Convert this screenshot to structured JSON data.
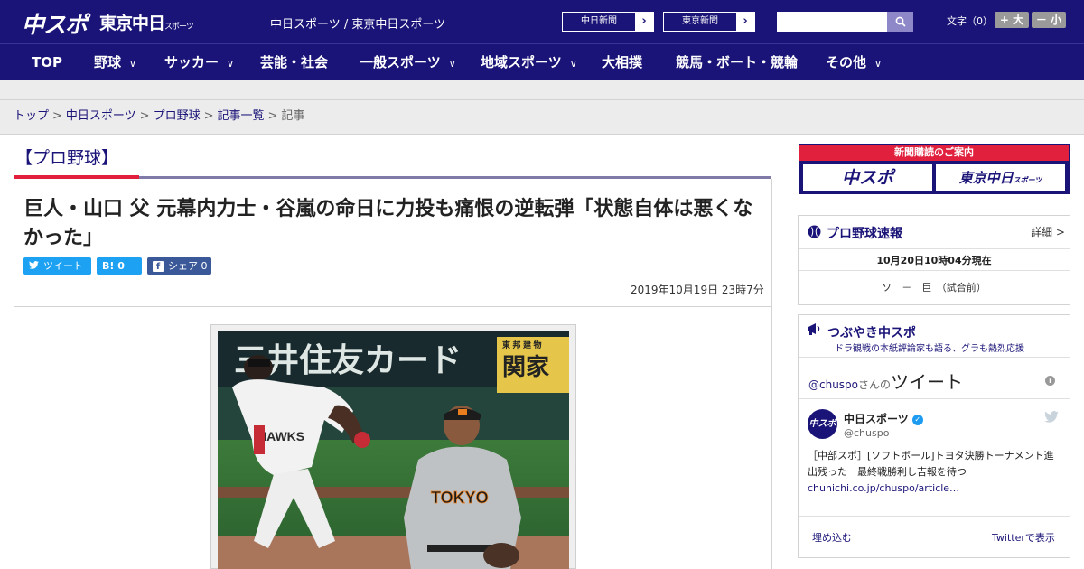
{
  "header": {
    "logo_chuspo": "中スポ",
    "logo_tokyo": "東京中日",
    "logo_tokyo_small": "スポーツ",
    "site_links": "中日スポーツ / 東京中日スポーツ",
    "chunichi_button": "中日新聞",
    "tokyo_button": "東京新聞",
    "search_placeholder": "",
    "fontsize_label": "文字（0）",
    "fontsize_up": "+ 大",
    "fontsize_down": "－ 小"
  },
  "nav": {
    "items": [
      {
        "label": "TOP",
        "dropdown": false
      },
      {
        "label": "野球",
        "dropdown": true
      },
      {
        "label": "サッカー",
        "dropdown": true
      },
      {
        "label": "芸能・社会",
        "dropdown": false
      },
      {
        "label": "一般スポーツ",
        "dropdown": true
      },
      {
        "label": "地域スポーツ",
        "dropdown": true
      },
      {
        "label": "大相撲",
        "dropdown": false
      },
      {
        "label": "競馬・ボート・競輪",
        "dropdown": false
      },
      {
        "label": "その他",
        "dropdown": true
      }
    ],
    "chevron": "∨"
  },
  "breadcrumb": {
    "items": [
      "トップ",
      "中日スポーツ",
      "プロ野球",
      "記事一覧"
    ],
    "current": "記事",
    "separator": ">"
  },
  "article": {
    "category": "【プロ野球】",
    "headline": "巨人・山口 父 元幕内力士・谷嵐の命日に力投も痛恨の逆転弾「状態自体は悪くなかった」",
    "tweet_label": "ツイート",
    "hatena_label": "B! 0",
    "facebook_label": "シェア 0",
    "date": "2019年10月19日 23時7分",
    "photo_sign_left": "三井住友カード",
    "photo_sign_right_top": "東 邦 建 物",
    "photo_sign_right": "関家",
    "photo_jersey_left": "HAWKS",
    "photo_jersey_right": "TOKYO"
  },
  "sidebar": {
    "promo_top": "新聞購読のご案内",
    "promo_logo_1": "中スポ",
    "promo_logo_2": "東京中日",
    "promo_logo_2_small": "スポーツ",
    "score_title": "プロ野球速報",
    "score_detail": "詳細 >",
    "score_date": "10月20日10時04分現在",
    "score_game": "ソ　－　巨　（試合前）",
    "tweet_title": "つぶやき中スポ",
    "tweet_subtitle": "ドラ観戦の本紙評論家も語る、グラも熱烈応援",
    "tweet_header_handle": "@chuspo",
    "tweet_header_san": "さんの",
    "tweet_header_big": "ツイート",
    "tweet_name": "中日スポーツ",
    "tweet_screen": "@chuspo",
    "tweet_text": "［中部スポ］[ソフトボール]トヨタ決勝トーナメント進出残った　最終戦勝利し吉報を待つ",
    "tweet_link": "chunichi.co.jp/chuspo/article…",
    "embed_label": "埋め込む",
    "view_label": "Twitterで表示"
  }
}
